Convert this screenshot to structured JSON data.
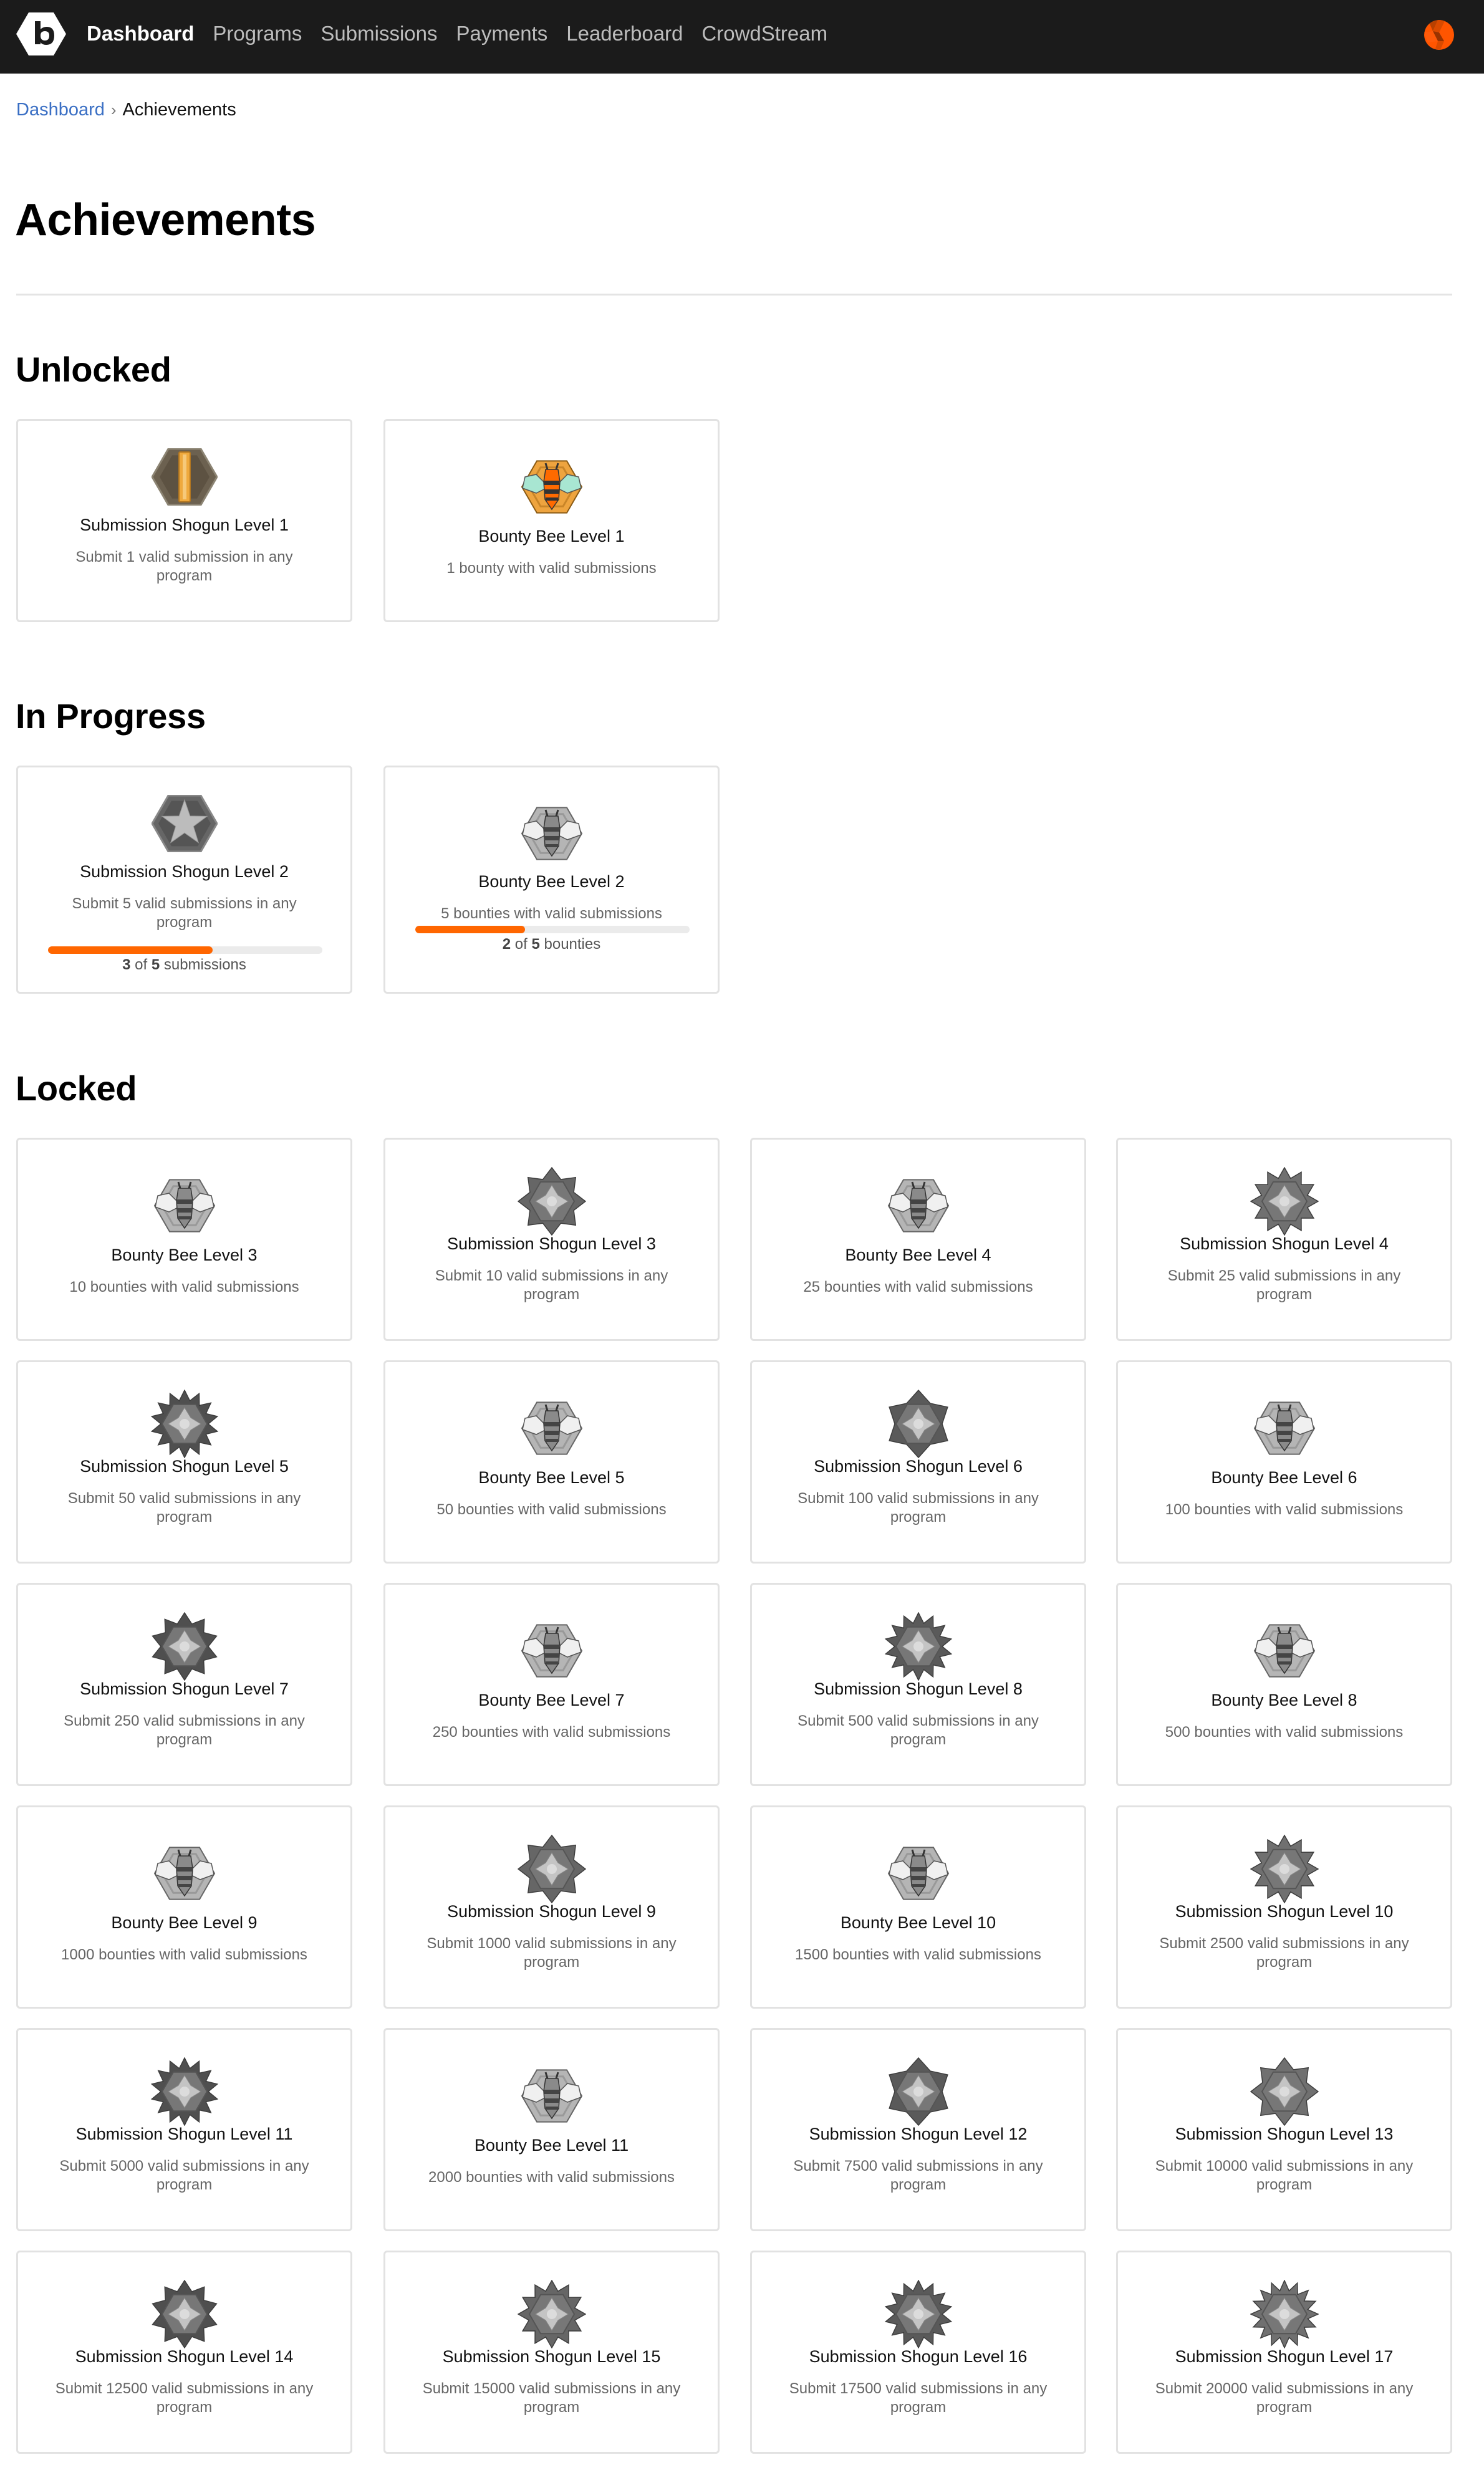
{
  "nav": {
    "logo_icon": "bugcrowd-hexagon-b-logo",
    "items": [
      {
        "label": "Dashboard",
        "active": true
      },
      {
        "label": "Programs",
        "active": false
      },
      {
        "label": "Submissions",
        "active": false
      },
      {
        "label": "Payments",
        "active": false
      },
      {
        "label": "Leaderboard",
        "active": false
      },
      {
        "label": "CrowdStream",
        "active": false
      }
    ],
    "avatar_icon": "user-avatar",
    "accent_color": "#ff5500"
  },
  "breadcrumb": {
    "parent": "Dashboard",
    "separator": "›",
    "current": "Achievements"
  },
  "page": {
    "title": "Achievements"
  },
  "colors": {
    "progress_fill": "#ff6600",
    "progress_track": "#ebebeb",
    "link": "#3a6fc4"
  },
  "sections": {
    "unlocked": {
      "title": "Unlocked",
      "cards": [
        {
          "title": "Submission Shogun Level 1",
          "description": "Submit 1 valid submission in any program",
          "icon": "shogun-badge-level-1"
        },
        {
          "title": "Bounty Bee Level 1",
          "description": "1 bounty with valid submissions",
          "icon": "bounty-bee-badge-level-1"
        }
      ]
    },
    "in_progress": {
      "title": "In Progress",
      "cards": [
        {
          "title": "Submission Shogun Level 2",
          "description": "Submit 5 valid submissions in any program",
          "icon": "shogun-badge-level-2",
          "progress": {
            "current": "3",
            "total": "5",
            "unit": "submissions",
            "fraction": 0.6,
            "of": "of"
          }
        },
        {
          "title": "Bounty Bee Level 2",
          "description": "5 bounties with valid submissions",
          "icon": "bounty-bee-badge-level-2",
          "progress": {
            "current": "2",
            "total": "5",
            "unit": "bounties",
            "fraction": 0.4,
            "of": "of"
          }
        }
      ]
    },
    "locked": {
      "title": "Locked",
      "cards": [
        {
          "title": "Bounty Bee Level 3",
          "description": "10 bounties with valid submissions",
          "icon": "bounty-bee-badge"
        },
        {
          "title": "Submission Shogun Level 3",
          "description": "Submit 10 valid submissions in any program",
          "icon": "shogun-badge"
        },
        {
          "title": "Bounty Bee Level 4",
          "description": "25 bounties with valid submissions",
          "icon": "bounty-bee-badge"
        },
        {
          "title": "Submission Shogun Level 4",
          "description": "Submit 25 valid submissions in any program",
          "icon": "shogun-badge"
        },
        {
          "title": "Submission Shogun Level 5",
          "description": "Submit 50 valid submissions in any program",
          "icon": "shogun-badge"
        },
        {
          "title": "Bounty Bee Level 5",
          "description": "50 bounties with valid submissions",
          "icon": "bounty-bee-badge"
        },
        {
          "title": "Submission Shogun Level 6",
          "description": "Submit 100 valid submissions in any program",
          "icon": "shogun-badge"
        },
        {
          "title": "Bounty Bee Level 6",
          "description": "100 bounties with valid submissions",
          "icon": "bounty-bee-badge"
        },
        {
          "title": "Submission Shogun Level 7",
          "description": "Submit 250 valid submissions in any program",
          "icon": "shogun-badge"
        },
        {
          "title": "Bounty Bee Level 7",
          "description": "250 bounties with valid submissions",
          "icon": "bounty-bee-badge"
        },
        {
          "title": "Submission Shogun Level 8",
          "description": "Submit 500 valid submissions in any program",
          "icon": "shogun-badge"
        },
        {
          "title": "Bounty Bee Level 8",
          "description": "500 bounties with valid submissions",
          "icon": "bounty-bee-badge"
        },
        {
          "title": "Bounty Bee Level 9",
          "description": "1000 bounties with valid submissions",
          "icon": "bounty-bee-badge"
        },
        {
          "title": "Submission Shogun Level 9",
          "description": "Submit 1000 valid submissions in any program",
          "icon": "shogun-badge"
        },
        {
          "title": "Bounty Bee Level 10",
          "description": "1500 bounties with valid submissions",
          "icon": "bounty-bee-badge"
        },
        {
          "title": "Submission Shogun Level 10",
          "description": "Submit 2500 valid submissions in any program",
          "icon": "shogun-badge"
        },
        {
          "title": "Submission Shogun Level 11",
          "description": "Submit 5000 valid submissions in any program",
          "icon": "shogun-badge"
        },
        {
          "title": "Bounty Bee Level 11",
          "description": "2000 bounties with valid submissions",
          "icon": "bounty-bee-badge"
        },
        {
          "title": "Submission Shogun Level 12",
          "description": "Submit 7500 valid submissions in any program",
          "icon": "shogun-badge"
        },
        {
          "title": "Submission Shogun Level 13",
          "description": "Submit 10000 valid submissions in any program",
          "icon": "shogun-badge"
        },
        {
          "title": "Submission Shogun Level 14",
          "description": "Submit 12500 valid submissions in any program",
          "icon": "shogun-badge"
        },
        {
          "title": "Submission Shogun Level 15",
          "description": "Submit 15000 valid submissions in any program",
          "icon": "shogun-badge"
        },
        {
          "title": "Submission Shogun Level 16",
          "description": "Submit 17500 valid submissions in any program",
          "icon": "shogun-badge"
        },
        {
          "title": "Submission Shogun Level 17",
          "description": "Submit 20000 valid submissions in any program",
          "icon": "shogun-badge"
        }
      ]
    }
  }
}
